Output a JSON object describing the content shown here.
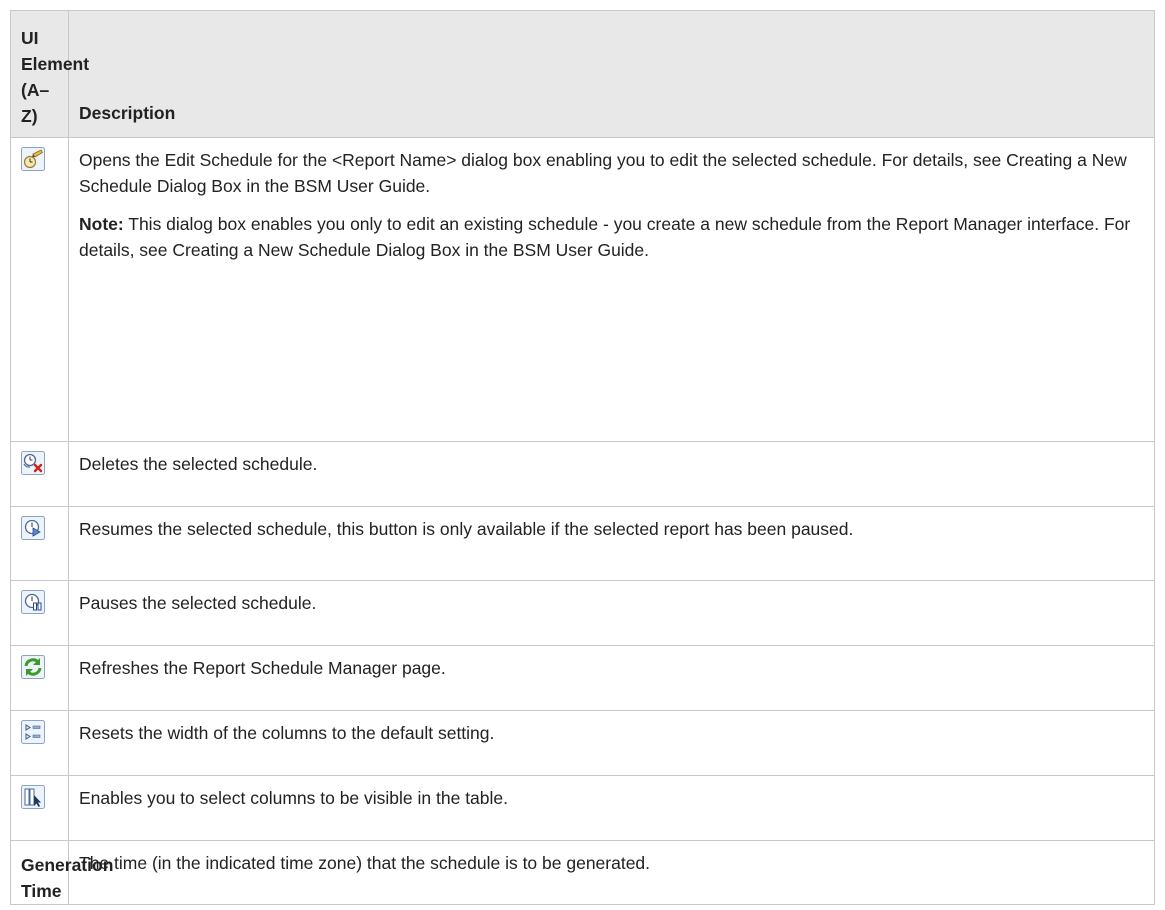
{
  "table": {
    "header": {
      "col1": "UI Element (A–Z)",
      "col2": "Description"
    },
    "rows": [
      {
        "icon": "edit-schedule-icon",
        "description": "Opens the Edit Schedule for the <Report Name> dialog box enabling you to edit the selected schedule. For details, see Creating a New Schedule Dialog Box in the BSM User Guide.",
        "note_label": "Note:",
        "note_text": " This dialog box enables you only to edit an existing schedule - you create a new schedule from the Report Manager interface. For details, see Creating a New Schedule Dialog Box in the BSM User Guide."
      },
      {
        "icon": "delete-schedule-icon",
        "description": "Deletes the selected schedule."
      },
      {
        "icon": "resume-schedule-icon",
        "description": "Resumes the selected schedule, this button is only available if the selected report has been paused."
      },
      {
        "icon": "pause-schedule-icon",
        "description": "Pauses the selected schedule."
      },
      {
        "icon": "refresh-icon",
        "description": "Refreshes the Report Schedule Manager page."
      },
      {
        "icon": "reset-column-width-icon",
        "description": "Resets the width of the columns to the default setting."
      },
      {
        "icon": "select-columns-icon",
        "description": "Enables you to select columns to be visible in the table."
      },
      {
        "element": "Generation Time",
        "description": "The time (in the indicated time zone) that the schedule is to be generated."
      }
    ]
  },
  "colors": {
    "header_bg": "#e8e8e8",
    "border": "#c8c8c8",
    "icon_frame": "#8ba4c4",
    "refresh_green": "#3a9a2a",
    "delete_red": "#d02020"
  }
}
